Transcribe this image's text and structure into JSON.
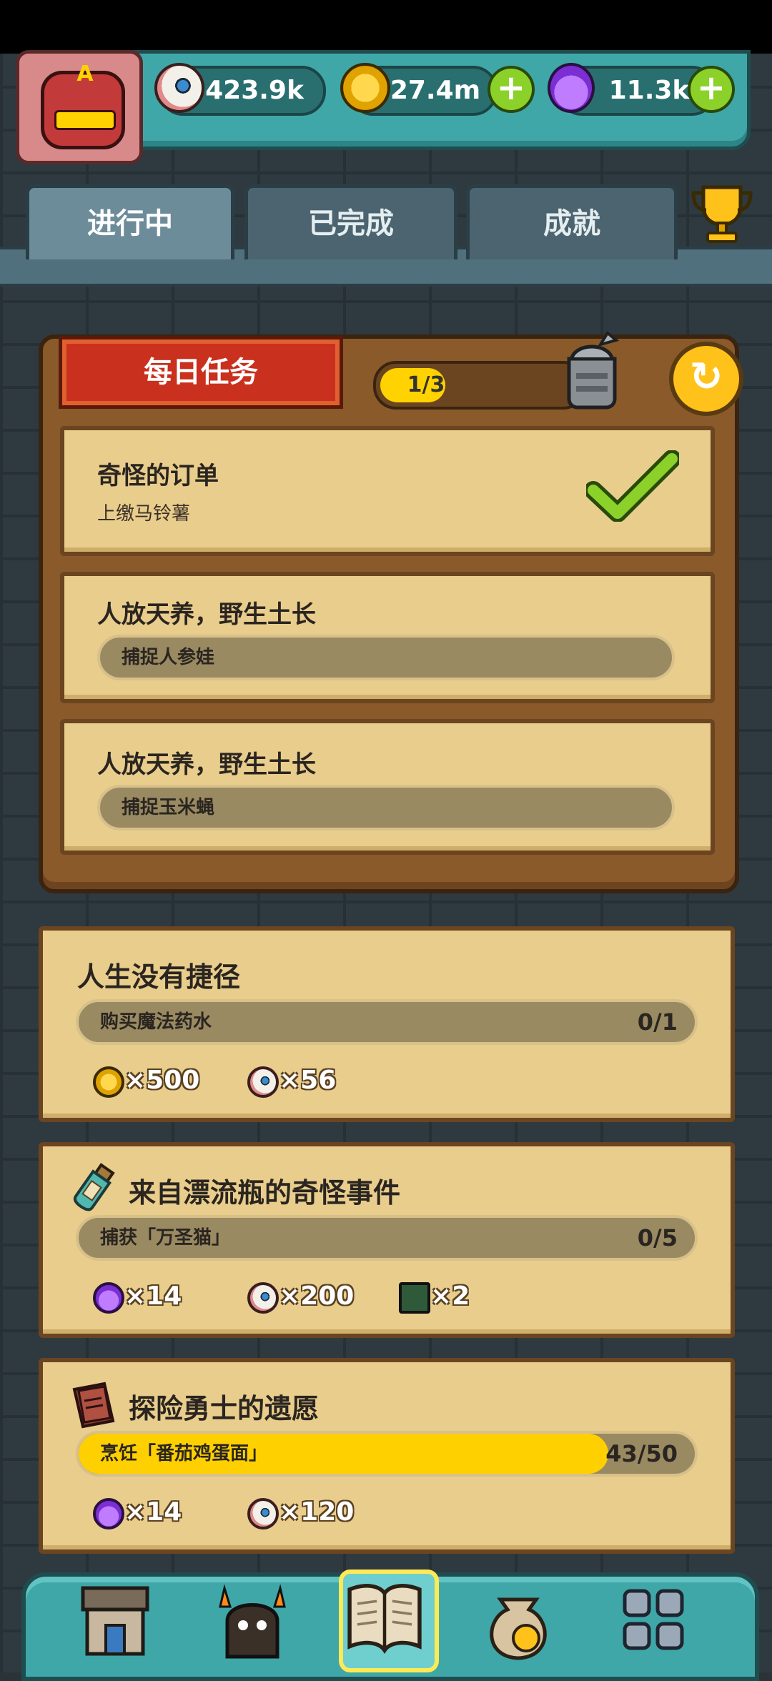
{
  "resources": {
    "eyes": "423.9k",
    "coins": "27.4m",
    "potions": "11.3k",
    "plus_label": "+"
  },
  "avatar": {
    "letter": "A"
  },
  "tabs": [
    {
      "label": "进行中",
      "active": true
    },
    {
      "label": "已完成",
      "active": false
    },
    {
      "label": "成就",
      "active": false
    }
  ],
  "daily": {
    "title": "每日任务",
    "progress_text": "1/3",
    "progress_fraction": 0.333,
    "refresh_icon": "↻",
    "tasks": [
      {
        "title": "奇怪的订单",
        "subtitle": "上缴马铃薯",
        "done": true
      },
      {
        "title": "人放天养，野生土长",
        "subtitle": "捕捉人参娃",
        "done": false
      },
      {
        "title": "人放天养，野生土长",
        "subtitle": "捕捉玉米蝇",
        "done": false
      }
    ]
  },
  "quests": [
    {
      "title": "人生没有捷径",
      "goal": "购买魔法药水",
      "count": "0/1",
      "progress_fraction": 0,
      "icon": "",
      "rewards": [
        {
          "icon": "coin-icon",
          "value": "×500"
        },
        {
          "icon": "eye-icon",
          "value": "×56"
        }
      ]
    },
    {
      "title": "来自漂流瓶的奇怪事件",
      "goal": "捕获「万圣猫」",
      "count": "0/5",
      "progress_fraction": 0,
      "icon": "bottle-icon",
      "rewards": [
        {
          "icon": "potion-icon",
          "value": "×14"
        },
        {
          "icon": "eye-icon",
          "value": "×200"
        },
        {
          "icon": "map-icon",
          "value": "×2"
        }
      ]
    },
    {
      "title": "探险勇士的遗愿",
      "goal": "烹饪「番茄鸡蛋面」",
      "count": "43/50",
      "progress_fraction": 0.86,
      "icon": "book-icon",
      "rewards": [
        {
          "icon": "potion-icon",
          "value": "×14"
        },
        {
          "icon": "eye-icon",
          "value": "×120"
        }
      ]
    }
  ],
  "nav": [
    {
      "name": "shop-icon",
      "active": false
    },
    {
      "name": "monster-icon",
      "active": false
    },
    {
      "name": "quest-book-icon",
      "active": true
    },
    {
      "name": "coin-bag-icon",
      "active": false
    },
    {
      "name": "grid-menu-icon",
      "active": false
    }
  ],
  "colors": {
    "wall": "#2f3a40",
    "teal": "#3fa7a8",
    "parchment": "#e9cd8c",
    "wood": "#8a5a2b",
    "banner_red": "#c9301e",
    "progress_yellow": "#ffd000",
    "plus_green": "#8bd12a"
  }
}
